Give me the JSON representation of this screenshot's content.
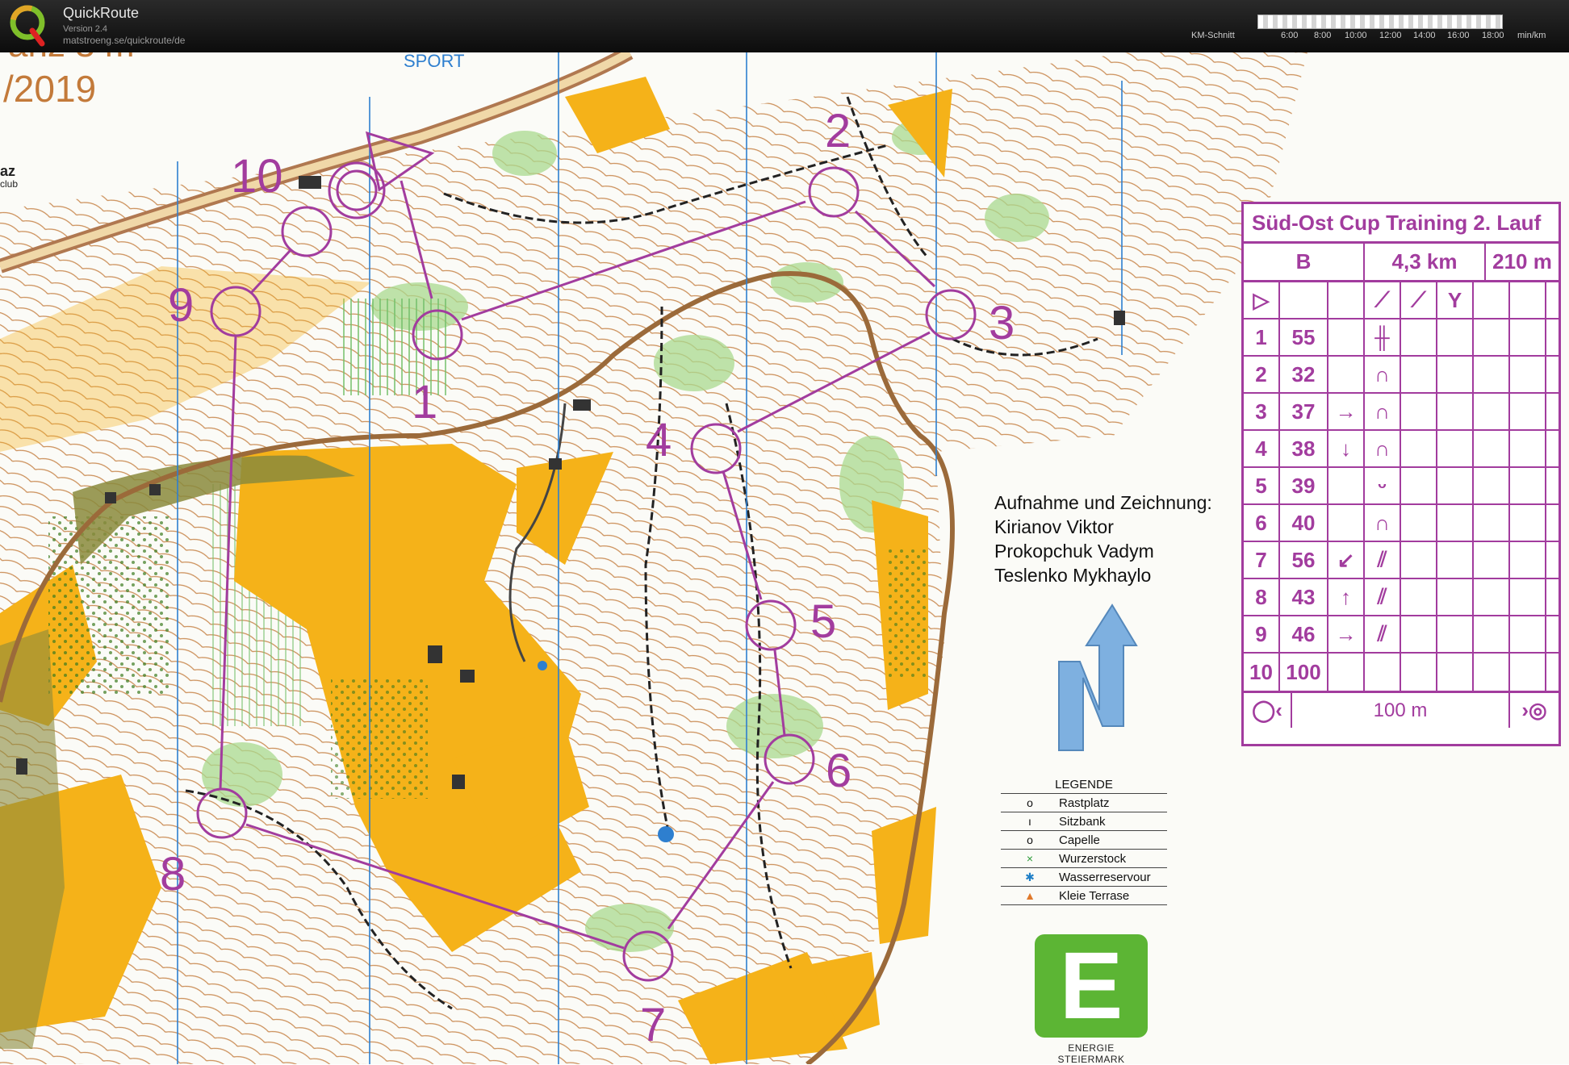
{
  "app": {
    "name": "QuickRoute",
    "version": "Version 2.4",
    "url": "matstroeng.se/quickroute/de",
    "logo_letter": "Q",
    "pace_legend": {
      "label": "KM-Schnitt",
      "ticks": [
        "6:00",
        "8:00",
        "10:00",
        "12:00",
        "14:00",
        "16:00",
        "18:00"
      ],
      "unit": "min/km"
    }
  },
  "map": {
    "corner_title_line1": "anz 3 m",
    "corner_title_line2": "/2019",
    "corner_club_short": "az",
    "corner_club_sub": "club",
    "sport_label": "SPORT",
    "course_color": "#a23c9e",
    "controls": [
      {
        "label": "1"
      },
      {
        "label": "2"
      },
      {
        "label": "3"
      },
      {
        "label": "4"
      },
      {
        "label": "5"
      },
      {
        "label": "6"
      },
      {
        "label": "7"
      },
      {
        "label": "8"
      },
      {
        "label": "9"
      },
      {
        "label": "10"
      }
    ]
  },
  "control_description": {
    "title": "Süd-Ost Cup Training 2. Lauf",
    "course": "B",
    "length": "4,3 km",
    "climb": "210 m",
    "rows": [
      {
        "num": "1",
        "code": "55",
        "dir": "",
        "feature": "╫"
      },
      {
        "num": "2",
        "code": "32",
        "dir": "",
        "feature": "∩"
      },
      {
        "num": "3",
        "code": "37",
        "dir": "→",
        "feature": "∩"
      },
      {
        "num": "4",
        "code": "38",
        "dir": "↓",
        "feature": "∩"
      },
      {
        "num": "5",
        "code": "39",
        "dir": "",
        "feature": "ᵕ"
      },
      {
        "num": "6",
        "code": "40",
        "dir": "",
        "feature": "∩"
      },
      {
        "num": "7",
        "code": "56",
        "dir": "↙",
        "feature": "⫽"
      },
      {
        "num": "8",
        "code": "43",
        "dir": "↑",
        "feature": "⫽"
      },
      {
        "num": "9",
        "code": "46",
        "dir": "→",
        "feature": "⫽"
      },
      {
        "num": "10",
        "code": "100",
        "dir": "",
        "feature": ""
      }
    ],
    "finish_distance": "100 m"
  },
  "credits": {
    "heading": "Aufnahme und Zeichnung:",
    "names": [
      "Kirianov Viktor",
      "Prokopchuk Vadym",
      "Teslenko Mykhaylo"
    ]
  },
  "legend": {
    "title": "LEGENDE",
    "items": [
      {
        "symbol": "o",
        "label": "Rastplatz",
        "color": "#111111"
      },
      {
        "symbol": "ı",
        "label": "Sitzbank",
        "color": "#111111"
      },
      {
        "symbol": "o",
        "label": "Capelle",
        "color": "#111111"
      },
      {
        "symbol": "×",
        "label": "Wurzerstock",
        "color": "#2e9b3a"
      },
      {
        "symbol": "✱",
        "label": "Wasserreservour",
        "color": "#1f7fc7"
      },
      {
        "symbol": "▲",
        "label": "Kleie Terrase",
        "color": "#e0792b"
      }
    ]
  },
  "sponsor": {
    "letter": "E",
    "name": "ENERGIE STEIERMARK",
    "color": "#5cb534"
  },
  "colors": {
    "open_land": "#f5b219",
    "forest_green": "#8fcf7a",
    "contour": "#b5692a",
    "north_arrow": "#7eb0e0"
  }
}
